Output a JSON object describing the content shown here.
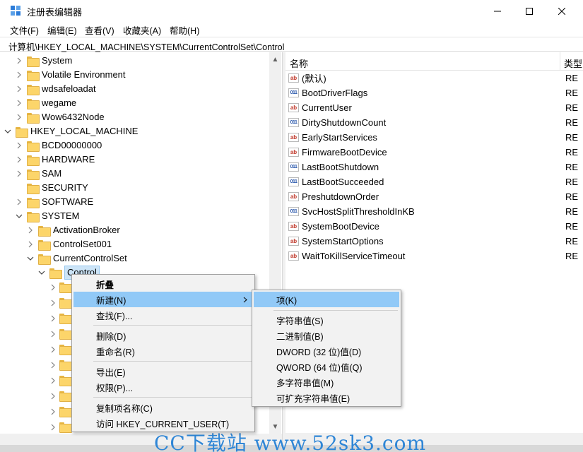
{
  "window": {
    "title": "注册表编辑器"
  },
  "menubar": [
    {
      "label": "文件(F)"
    },
    {
      "label": "编辑(E)"
    },
    {
      "label": "查看(V)"
    },
    {
      "label": "收藏夹(A)"
    },
    {
      "label": "帮助(H)"
    }
  ],
  "address": "计算机\\HKEY_LOCAL_MACHINE\\SYSTEM\\CurrentControlSet\\Control",
  "tree": [
    {
      "label": "System",
      "expanded": false
    },
    {
      "label": "Volatile Environment",
      "expanded": false
    },
    {
      "label": "wdsafeloadat",
      "expanded": false
    },
    {
      "label": "wegame",
      "expanded": false
    },
    {
      "label": "Wow6432Node",
      "expanded": false
    },
    {
      "label": "HKEY_LOCAL_MACHINE",
      "expanded": true
    },
    {
      "label": "BCD00000000",
      "expanded": false
    },
    {
      "label": "HARDWARE",
      "expanded": false
    },
    {
      "label": "SAM",
      "expanded": false
    },
    {
      "label": "SECURITY",
      "expanded": false
    },
    {
      "label": "SOFTWARE",
      "expanded": false
    },
    {
      "label": "SYSTEM",
      "expanded": true
    },
    {
      "label": "ActivationBroker",
      "expanded": false
    },
    {
      "label": "ControlSet001",
      "expanded": false
    },
    {
      "label": "CurrentControlSet",
      "expanded": true
    },
    {
      "label": "Control",
      "expanded": true,
      "selected": true
    }
  ],
  "list": {
    "col_name": "名称",
    "col_type": "类型",
    "values": [
      {
        "name": "(默认)",
        "kind": "sz",
        "type": "RE"
      },
      {
        "name": "BootDriverFlags",
        "kind": "bin",
        "type": "RE"
      },
      {
        "name": "CurrentUser",
        "kind": "sz",
        "type": "RE"
      },
      {
        "name": "DirtyShutdownCount",
        "kind": "bin",
        "type": "RE"
      },
      {
        "name": "EarlyStartServices",
        "kind": "sz",
        "type": "RE"
      },
      {
        "name": "FirmwareBootDevice",
        "kind": "sz",
        "type": "RE"
      },
      {
        "name": "LastBootShutdown",
        "kind": "bin",
        "type": "RE"
      },
      {
        "name": "LastBootSucceeded",
        "kind": "bin",
        "type": "RE"
      },
      {
        "name": "PreshutdownOrder",
        "kind": "sz",
        "type": "RE"
      },
      {
        "name": "SvcHostSplitThresholdInKB",
        "kind": "bin",
        "type": "RE"
      },
      {
        "name": "SystemBootDevice",
        "kind": "sz",
        "type": "RE"
      },
      {
        "name": "SystemStartOptions",
        "kind": "sz",
        "type": "RE"
      },
      {
        "name": "WaitToKillServiceTimeout",
        "kind": "sz",
        "type": "RE"
      }
    ]
  },
  "context_menu": {
    "collapse": "折叠",
    "new": "新建(N)",
    "find": "查找(F)...",
    "delete": "删除(D)",
    "rename": "重命名(R)",
    "export": "导出(E)",
    "permissions": "权限(P)...",
    "copy_key_name": "复制项名称(C)",
    "visit": "访问 HKEY_CURRENT_USER(T)"
  },
  "submenu": {
    "key": "项(K)",
    "string": "字符串值(S)",
    "binary": "二进制值(B)",
    "dword": "DWORD (32 位)值(D)",
    "qword": "QWORD (64 位)值(Q)",
    "multi_string": "多字符串值(M)",
    "expand_string": "可扩充字符串值(E)"
  },
  "watermark": "CC下载站 www.52sk3.com",
  "colors": {
    "highlight": "#91c9f7",
    "selection": "#cce4f7",
    "folder": "#fcd56a",
    "watermark": "#2f86d6"
  }
}
